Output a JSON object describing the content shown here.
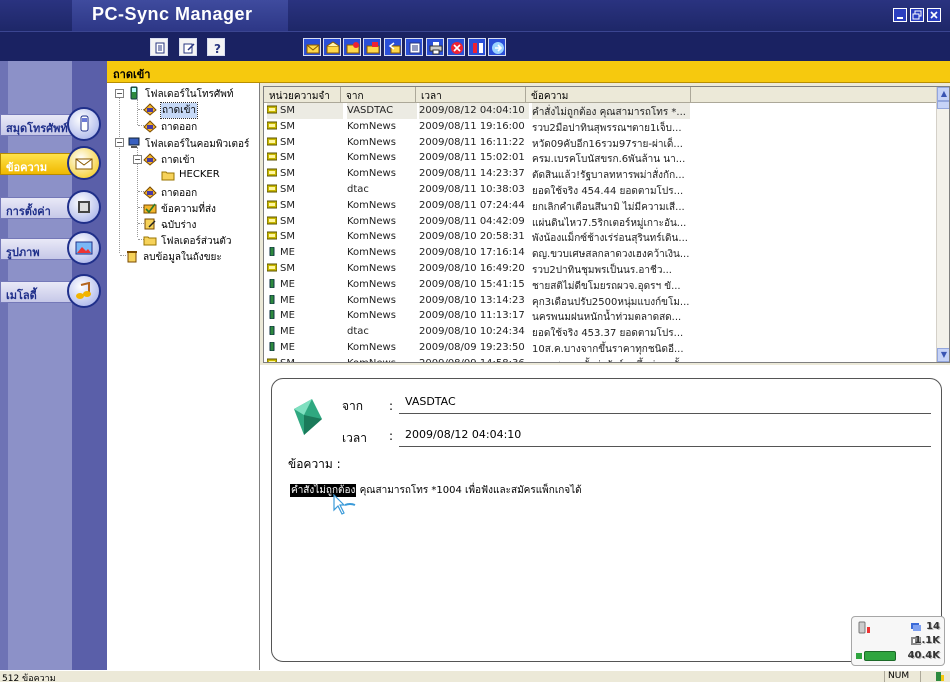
{
  "app": {
    "title": "PC-Sync Manager",
    "window_buttons": [
      "minimize",
      "restore",
      "close"
    ]
  },
  "toolbar": {
    "left_icons": [
      "clipboard-icon",
      "edit-note-icon",
      "help-icon"
    ],
    "right_icons": [
      "new-message-icon",
      "open-message-icon",
      "forward-message-icon",
      "send-message-icon",
      "reply-message-icon",
      "list-view-icon",
      "print-icon",
      "delete-icon",
      "sync-icon",
      "connect-icon"
    ]
  },
  "nav": {
    "items": [
      {
        "label": "สมุดโทรศัพท์",
        "icon": "phone-icon",
        "active": false
      },
      {
        "label": "ข้อความ",
        "icon": "envelope-icon",
        "active": true
      },
      {
        "label": "การตั้งค่า",
        "icon": "settings-icon",
        "active": false
      },
      {
        "label": "รูปภาพ",
        "icon": "picture-icon",
        "active": false
      },
      {
        "label": "เมโลดี้",
        "icon": "music-icon",
        "active": false
      }
    ]
  },
  "header": {
    "folder_title": "ถาดเข้า"
  },
  "tree": {
    "phone_folder": "โฟลเดอร์ในโทรศัพท์",
    "phone_inbox": "ถาดเข้า",
    "phone_outbox": "ถาดออก",
    "pc_folder": "โฟลเดอร์ในคอมพิวเตอร์",
    "pc_inbox": "ถาดเข้า",
    "pc_inbox_sub": "HECKER",
    "pc_outbox": "ถาดออก",
    "pc_sent": "ข้อความที่ส่ง",
    "pc_drafts": "ฉบับร่าง",
    "pc_personal": "โฟลเดอร์ส่วนตัว",
    "trash": "ลบข้อมูลในถังขยะ"
  },
  "list": {
    "columns": [
      "หน่วยความจำ",
      "จาก",
      "เวลา",
      "ข้อความ"
    ],
    "rows": [
      {
        "mem": "SM",
        "from": "VASDTAC",
        "time": "2009/08/12 04:04:10",
        "msg": "คำสั่งไม่ถูกต้อง คุณสามารถโทร *..."
      },
      {
        "mem": "SM",
        "from": "KomNews",
        "time": "2009/08/11 19:16:00",
        "msg": "รวบ2มือปาทินสุพรรณฯตาย1เจ็บ..."
      },
      {
        "mem": "SM",
        "from": "KomNews",
        "time": "2009/08/11 16:11:22",
        "msg": "หวัด09คับอีก16รวม97ราย-ผ่าเด็..."
      },
      {
        "mem": "SM",
        "from": "KomNews",
        "time": "2009/08/11 15:02:01",
        "msg": "ครม.เบรคโบนัสขรก.6พันล้าน นา..."
      },
      {
        "mem": "SM",
        "from": "KomNews",
        "time": "2009/08/11 14:23:37",
        "msg": "ตัดสินแล้ว!รัฐบาลทหารพม่าสั่งกัก..."
      },
      {
        "mem": "SM",
        "from": "dtac",
        "time": "2009/08/11 10:38:03",
        "msg": "ยอดใช้จริง 454.44 ยอดตามโปร..."
      },
      {
        "mem": "SM",
        "from": "KomNews",
        "time": "2009/08/11 07:24:44",
        "msg": "ยกเลิกคำเตือนสึนามิ ไม่มีความเสี..."
      },
      {
        "mem": "SM",
        "from": "KomNews",
        "time": "2009/08/11 04:42:09",
        "msg": "แผ่นดินไหว7.5ริกเตอร์หมู่เกาะอัน..."
      },
      {
        "mem": "SM",
        "from": "KomNews",
        "time": "2009/08/10 20:58:31",
        "msg": "พังน้องแม็กซ์ช้างเร่ร่อนสุรินทร์เดิน..."
      },
      {
        "mem": "ME",
        "from": "KomNews",
        "time": "2009/08/10 17:16:14",
        "msg": "ดญ.ขวบเศษสลกลาดวงเฮงคว้าเงิน..."
      },
      {
        "mem": "SM",
        "from": "KomNews",
        "time": "2009/08/10 16:49:20",
        "msg": "รวบ2ปาทินชุมพรเป็นนร.อาชีว..."
      },
      {
        "mem": "ME",
        "from": "KomNews",
        "time": "2009/08/10 15:41:15",
        "msg": "ชายสติไม่ดีขโมยรถผวจ.อุดรฯ ขั..."
      },
      {
        "mem": "ME",
        "from": "KomNews",
        "time": "2009/08/10 13:14:23",
        "msg": "คุก3เดือนปรับ2500หนุ่มแบงก์ขโม..."
      },
      {
        "mem": "ME",
        "from": "KomNews",
        "time": "2009/08/10 11:13:17",
        "msg": "นครพนมฝนหนักน้ำท่วมตลาดสด..."
      },
      {
        "mem": "ME",
        "from": "dtac",
        "time": "2009/08/10 10:24:34",
        "msg": "ยอดใช้จริง 453.37 ยอดตามโปร..."
      },
      {
        "mem": "ME",
        "from": "KomNews",
        "time": "2009/08/09 19:23:50",
        "msg": "10ส.ค.บางจากขึ้นราคาทุกชนิดอี..."
      },
      {
        "mem": "SM",
        "from": "KomNews",
        "time": "2009/08/09 14:58:36",
        "msg": "นอก สุขเพรชั้งค่ายักร์ยกขึ้นถ่ายครั้ง"
      }
    ]
  },
  "preview": {
    "from_label": "จาก",
    "from_value": "VASDTAC",
    "time_label": "เวลา",
    "time_value": "2009/08/12 04:04:10",
    "message_label": "ข้อความ :",
    "colon": ":",
    "body_highlight": "คำสั่งไม่ถูกต้อง",
    "body_rest": " คุณสามารถโทร *1004 เพื่อฟังและสมัครแพ็กเกจได้"
  },
  "widget": {
    "messages_count": "14",
    "memory_used": "1.1K",
    "battery_free": "40.4K",
    "battery_level": 0.85
  },
  "status": {
    "count_text": "512 ข้อความ",
    "num_indicator": "NUM"
  },
  "colors": {
    "title_bg": "#1e2768",
    "header_yellow": "#f6c90e",
    "nav_active": "#f0b800",
    "sidebar": "#8c91c8"
  }
}
